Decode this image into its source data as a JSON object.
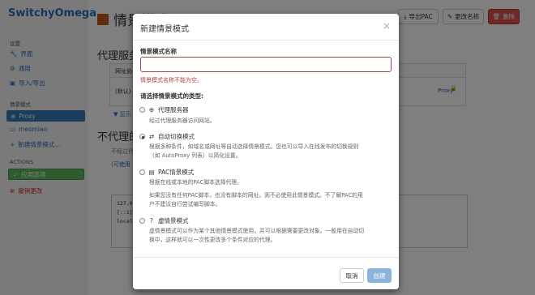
{
  "app": {
    "brand": "SwitchyOmega",
    "sidebar": {
      "settings_header": "设置",
      "settings_items": [
        {
          "label": "界面",
          "icon": "wrench-icon"
        },
        {
          "label": "通用",
          "icon": "gear-icon"
        },
        {
          "label": "导入/导出",
          "icon": "floppy-icon"
        }
      ],
      "profiles_header": "情景模式",
      "profiles": [
        {
          "label": "Proxy",
          "icon": "globe-icon",
          "active": true
        },
        {
          "label": "meomiao",
          "icon": "monitor-icon",
          "active": false
        }
      ],
      "new_profile": "新建情景模式...",
      "actions_header": "ACTIONS",
      "apply": "应用选项",
      "discard": "撤销更改"
    },
    "main": {
      "title": "情景模式：P",
      "export_pac": "导出PAC",
      "rename": "更改名称",
      "delete": "删除",
      "proxy_servers_heading": "代理服务",
      "table_header": "网址协",
      "default_row": "(默认)",
      "proxy_value": "Proxy",
      "bypass_heading": "不代理的",
      "bypass_desc": "不经过代",
      "bypass_link": "(可使用",
      "show_more": "▼ 显示",
      "bypass_list": [
        "127.0",
        "[::1]",
        "local"
      ]
    }
  },
  "modal": {
    "title": "新建情景模式",
    "close": "×",
    "name_label": "情景模式名称",
    "name_value": "",
    "error": "情景模式名称不能为空。",
    "type_prompt": "请选择情景模式的类型:",
    "options": [
      {
        "label": "代理服务器",
        "icon": "globe-icon",
        "selected": false,
        "desc": [
          "经过代理服务器访问网站。"
        ]
      },
      {
        "label": "自动切换模式",
        "icon": "retweet-icon",
        "selected": true,
        "desc": [
          "根据多种条件，如域名或网址等自动选择情景模式。您也可以导入在线发布的切换规则",
          "（如 AutoProxy 列表）以简化设置。"
        ]
      },
      {
        "label": "PAC情景模式",
        "icon": "file-icon",
        "selected": false,
        "desc": [
          "根据在线或本地的PAC脚本选择代理。",
          "如果您没有任何PAC脚本，也没有脚本的网址，则不必使用此情景模式。不了解PAC的用",
          "户不建议自行尝试编写脚本。"
        ]
      },
      {
        "label": "虚情景模式",
        "icon": "question-circle-icon",
        "selected": false,
        "desc": [
          "虚情景模式可以作为某个其他情景模式使用，并可以根据需要更改对象。一般用在自动切",
          "换中，这样就可以一次性更改多个条件对应的代理。"
        ]
      }
    ],
    "cancel": "取消",
    "create": "创建",
    "colors": {
      "error": "#a94442",
      "primary_disabled": "#8ab4db",
      "overlay": "rgba(0,0,0,0.5)"
    }
  }
}
